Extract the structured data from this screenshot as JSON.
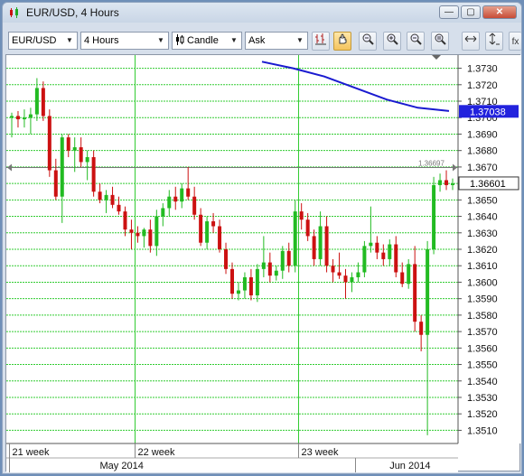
{
  "window": {
    "title": "EUR/USD,  4 Hours",
    "minimize_label": "—",
    "maximize_label": "▢",
    "close_label": "✕"
  },
  "toolbar": {
    "instrument": "EUR/USD",
    "period": "4 Hours",
    "chart_type": "Candle",
    "price_side": "Ask",
    "icons": [
      "bar-chart-type-icon",
      "crosshair-hand-icon",
      "zoom-out-icon",
      "zoom-in-icon",
      "zoom-minus-icon",
      "zoom-reset-icon",
      "scroll-left-right-icon",
      "price-scale-icon",
      "indicator-fx-icon"
    ],
    "fx_label": "fx"
  },
  "colors": {
    "bull": "#22bb22",
    "bear": "#cc1111",
    "grid_h": "#33cc33",
    "grid_v": "#33cc33",
    "ma_line": "#1a1ad0",
    "price_tag_ma": "#2222dd",
    "price_tag_current": "#ffffff"
  },
  "chart_data": {
    "type": "candlestick",
    "instrument": "EUR/USD",
    "timeframe": "4 Hours",
    "ylim": [
      1.3502,
      1.3738
    ],
    "y_ticks": [
      "1.3730",
      "1.3720",
      "1.3710",
      "1.3700",
      "1.3690",
      "1.3680",
      "1.3670",
      "1.3660",
      "1.3650",
      "1.3640",
      "1.3630",
      "1.3620",
      "1.3610",
      "1.3600",
      "1.3590",
      "1.3580",
      "1.3570",
      "1.3560",
      "1.3550",
      "1.3540",
      "1.3530",
      "1.3520",
      "1.3510"
    ],
    "week_labels": [
      "21 week",
      "22 week",
      "23 week"
    ],
    "month_labels": [
      "May 2014",
      "Jun 2014"
    ],
    "current_price": "1.36601",
    "ma_price": "1.37038",
    "horizontal_line_label": "1.36697",
    "moving_average": [
      1.3734,
      1.373,
      1.3725,
      1.3718,
      1.3711,
      1.3706,
      1.3704
    ],
    "candles": [
      [
        1.37,
        1.3703,
        1.3688,
        1.3701
      ],
      [
        1.3701,
        1.3704,
        1.3694,
        1.3699
      ],
      [
        1.3699,
        1.3705,
        1.3694,
        1.37
      ],
      [
        1.37,
        1.3706,
        1.369,
        1.3702
      ],
      [
        1.3702,
        1.3724,
        1.3698,
        1.3718
      ],
      [
        1.3718,
        1.3722,
        1.3698,
        1.3701
      ],
      [
        1.3701,
        1.3705,
        1.3664,
        1.3668
      ],
      [
        1.3668,
        1.3675,
        1.365,
        1.3652
      ],
      [
        1.3652,
        1.369,
        1.3636,
        1.3688
      ],
      [
        1.3688,
        1.369,
        1.3676,
        1.368
      ],
      [
        1.368,
        1.3688,
        1.3667,
        1.3682
      ],
      [
        1.3682,
        1.3688,
        1.367,
        1.3673
      ],
      [
        1.3673,
        1.368,
        1.3662,
        1.3676
      ],
      [
        1.3676,
        1.368,
        1.3652,
        1.3655
      ],
      [
        1.3655,
        1.366,
        1.3648,
        1.365
      ],
      [
        1.365,
        1.3656,
        1.3642,
        1.3653
      ],
      [
        1.3653,
        1.3658,
        1.3645,
        1.3647
      ],
      [
        1.3647,
        1.3652,
        1.3641,
        1.3643
      ],
      [
        1.3643,
        1.3646,
        1.3628,
        1.3632
      ],
      [
        1.3632,
        1.3638,
        1.362,
        1.363
      ],
      [
        1.363,
        1.3634,
        1.3624,
        1.3628
      ],
      [
        1.3628,
        1.3633,
        1.3621,
        1.3632
      ],
      [
        1.3632,
        1.3638,
        1.3618,
        1.3622
      ],
      [
        1.3622,
        1.3644,
        1.3616,
        1.364
      ],
      [
        1.364,
        1.3648,
        1.3634,
        1.3645
      ],
      [
        1.3645,
        1.3656,
        1.364,
        1.3652
      ],
      [
        1.3652,
        1.3658,
        1.3644,
        1.3649
      ],
      [
        1.3649,
        1.366,
        1.3645,
        1.3657
      ],
      [
        1.3657,
        1.367,
        1.365,
        1.3652
      ],
      [
        1.3652,
        1.3658,
        1.3638,
        1.3641
      ],
      [
        1.3641,
        1.3645,
        1.3622,
        1.3624
      ],
      [
        1.3624,
        1.364,
        1.362,
        1.3637
      ],
      [
        1.3637,
        1.3642,
        1.363,
        1.3634
      ],
      [
        1.3634,
        1.3638,
        1.3618,
        1.362
      ],
      [
        1.362,
        1.3624,
        1.3605,
        1.3608
      ],
      [
        1.3608,
        1.3612,
        1.359,
        1.3593
      ],
      [
        1.3593,
        1.36,
        1.3589,
        1.3595
      ],
      [
        1.3595,
        1.3606,
        1.359,
        1.3603
      ],
      [
        1.3603,
        1.3608,
        1.3589,
        1.3592
      ],
      [
        1.3592,
        1.3611,
        1.3588,
        1.3608
      ],
      [
        1.3608,
        1.3628,
        1.3603,
        1.3612
      ],
      [
        1.3612,
        1.3618,
        1.36,
        1.3604
      ],
      [
        1.3604,
        1.361,
        1.3601,
        1.3607
      ],
      [
        1.3607,
        1.3622,
        1.3602,
        1.3619
      ],
      [
        1.3619,
        1.3624,
        1.3606,
        1.361
      ],
      [
        1.361,
        1.365,
        1.3606,
        1.3643
      ],
      [
        1.3643,
        1.3648,
        1.3632,
        1.3638
      ],
      [
        1.3638,
        1.3642,
        1.3625,
        1.3628
      ],
      [
        1.3628,
        1.3632,
        1.361,
        1.3614
      ],
      [
        1.3614,
        1.3643,
        1.361,
        1.3634
      ],
      [
        1.3634,
        1.364,
        1.3606,
        1.361
      ],
      [
        1.361,
        1.3614,
        1.36,
        1.3606
      ],
      [
        1.3606,
        1.3618,
        1.3602,
        1.3604
      ],
      [
        1.3604,
        1.3608,
        1.359,
        1.36
      ],
      [
        1.36,
        1.3606,
        1.3594,
        1.3603
      ],
      [
        1.3603,
        1.3612,
        1.36,
        1.3606
      ],
      [
        1.3606,
        1.3625,
        1.3603,
        1.3622
      ],
      [
        1.3622,
        1.3646,
        1.3618,
        1.3624
      ],
      [
        1.3624,
        1.3628,
        1.3614,
        1.3618
      ],
      [
        1.3618,
        1.3623,
        1.361,
        1.3614
      ],
      [
        1.3614,
        1.3626,
        1.361,
        1.3623
      ],
      [
        1.3623,
        1.3628,
        1.3603,
        1.3606
      ],
      [
        1.3606,
        1.3612,
        1.3597,
        1.3599
      ],
      [
        1.3599,
        1.3614,
        1.3596,
        1.3611
      ],
      [
        1.3611,
        1.3622,
        1.357,
        1.3576
      ],
      [
        1.3576,
        1.358,
        1.3558,
        1.3568
      ],
      [
        1.3568,
        1.3625,
        1.3507,
        1.362
      ],
      [
        1.362,
        1.3664,
        1.3617,
        1.3659
      ],
      [
        1.3659,
        1.3666,
        1.3655,
        1.3662
      ],
      [
        1.3662,
        1.3668,
        1.3656,
        1.3659
      ],
      [
        1.3659,
        1.3663,
        1.3656,
        1.366
      ]
    ]
  }
}
